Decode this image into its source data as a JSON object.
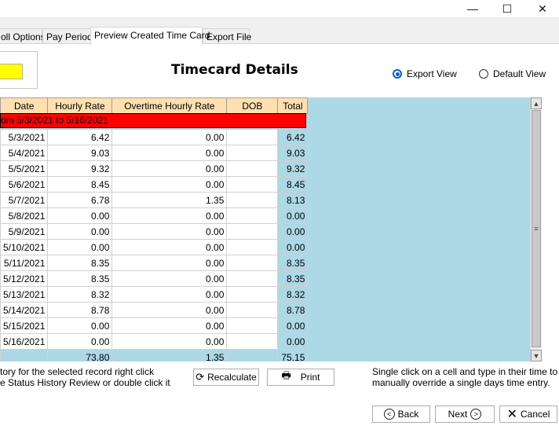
{
  "window": {
    "minimize_glyph": "—",
    "maximize_glyph": "☐",
    "close_glyph": "✕"
  },
  "tabs": [
    {
      "label": "oll Options"
    },
    {
      "label": "Pay Period"
    },
    {
      "label": "Preview Created Time Card"
    },
    {
      "label": "Export File"
    }
  ],
  "page_title": "Timecard Details",
  "view_options": [
    {
      "label": "Export View",
      "checked": true
    },
    {
      "label": "Default View",
      "checked": false
    }
  ],
  "grid": {
    "columns": [
      "Date",
      "Hourly Rate",
      "Overtime Hourly Rate",
      "DOB",
      "Total"
    ],
    "group_label": "om 5/3/2021 to 5/16/2021",
    "rows": [
      {
        "date": "5/3/2021",
        "hourly": "6.42",
        "overtime": "0.00",
        "dob": "",
        "total": "6.42"
      },
      {
        "date": "5/4/2021",
        "hourly": "9.03",
        "overtime": "0.00",
        "dob": "",
        "total": "9.03"
      },
      {
        "date": "5/5/2021",
        "hourly": "9.32",
        "overtime": "0.00",
        "dob": "",
        "total": "9.32"
      },
      {
        "date": "5/6/2021",
        "hourly": "8.45",
        "overtime": "0.00",
        "dob": "",
        "total": "8.45"
      },
      {
        "date": "5/7/2021",
        "hourly": "6.78",
        "overtime": "1.35",
        "dob": "",
        "total": "8.13"
      },
      {
        "date": "5/8/2021",
        "hourly": "0.00",
        "overtime": "0.00",
        "dob": "",
        "total": "0.00"
      },
      {
        "date": "5/9/2021",
        "hourly": "0.00",
        "overtime": "0.00",
        "dob": "",
        "total": "0.00"
      },
      {
        "date": "5/10/2021",
        "hourly": "0.00",
        "overtime": "0.00",
        "dob": "",
        "total": "0.00"
      },
      {
        "date": "5/11/2021",
        "hourly": "8.35",
        "overtime": "0.00",
        "dob": "",
        "total": "8.35"
      },
      {
        "date": "5/12/2021",
        "hourly": "8.35",
        "overtime": "0.00",
        "dob": "",
        "total": "8.35"
      },
      {
        "date": "5/13/2021",
        "hourly": "8.32",
        "overtime": "0.00",
        "dob": "",
        "total": "8.32"
      },
      {
        "date": "5/14/2021",
        "hourly": "8.78",
        "overtime": "0.00",
        "dob": "",
        "total": "8.78"
      },
      {
        "date": "5/15/2021",
        "hourly": "0.00",
        "overtime": "0.00",
        "dob": "",
        "total": "0.00"
      },
      {
        "date": "5/16/2021",
        "hourly": "0.00",
        "overtime": "0.00",
        "dob": "",
        "total": "0.00"
      }
    ],
    "summary": {
      "date": "",
      "hourly": "73.80",
      "overtime": "1.35",
      "dob": "",
      "total": "75.15"
    }
  },
  "help_left": {
    "line1": "tory for the selected record right click",
    "line2": "e Status History Review or double click it"
  },
  "buttons": {
    "recalculate": "Recalculate",
    "print": "Print",
    "back": "Back",
    "next": "Next",
    "cancel": "Cancel"
  },
  "help_right": {
    "line1": "Single click on a cell and type in their time to",
    "line2": "manually override a single days time entry."
  },
  "colors": {
    "grid_background": "#add8e6",
    "header_background": "#ffe0b0",
    "group_bar": "#ff0000",
    "highlight_box": "#ffff00"
  }
}
